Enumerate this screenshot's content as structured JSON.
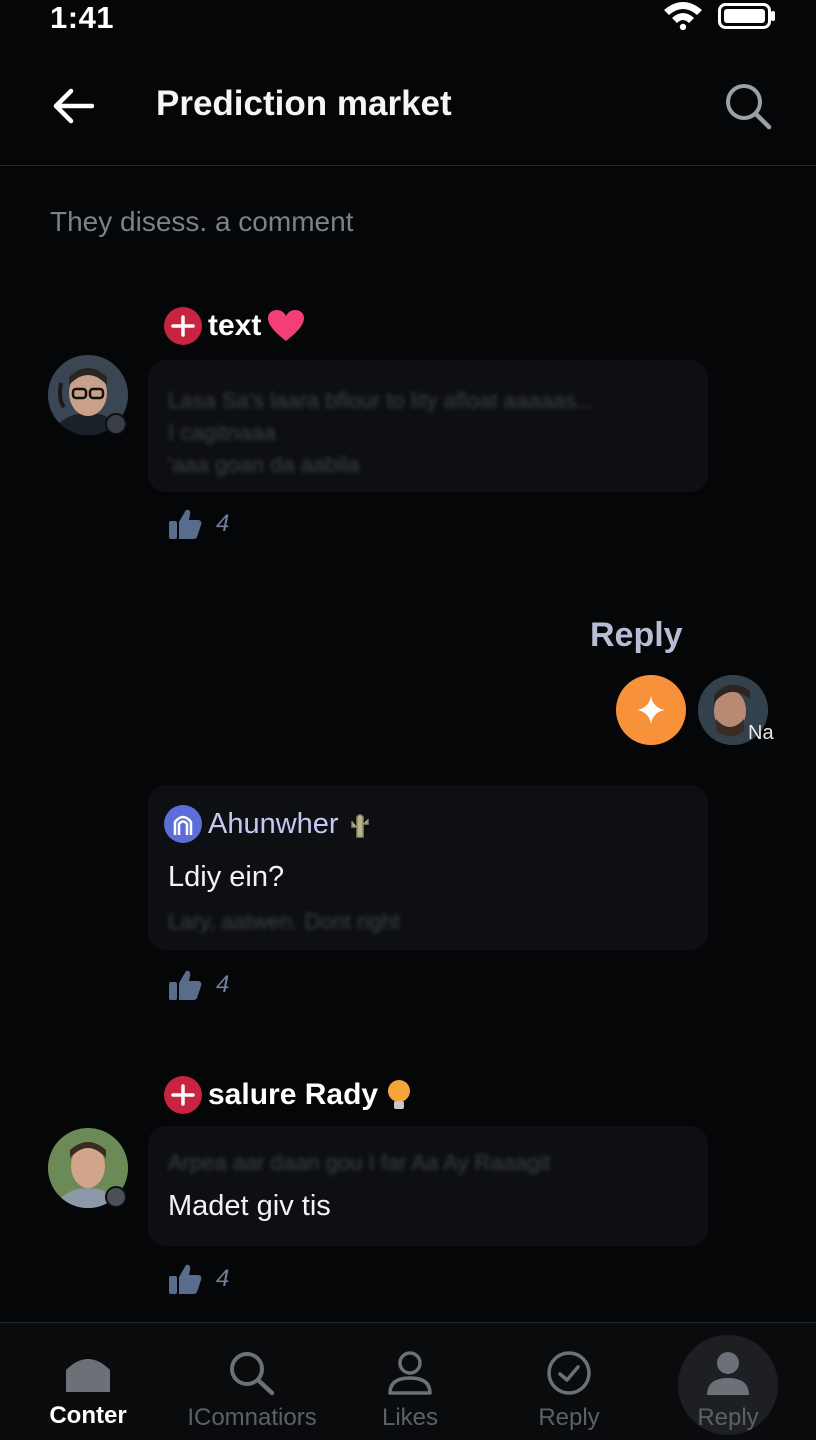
{
  "status_bar": {
    "time": "1:41"
  },
  "header": {
    "title": "Prediction market"
  },
  "section": {
    "subtitle": "They disess. a comment"
  },
  "comments": [
    {
      "author": "text",
      "blurred_lines": [
        "Lasa Sa's laara bflour to lity afloat aaaaas...",
        "I cagitnaaa",
        "'aaa goan da aabila"
      ],
      "likes": "4"
    },
    {
      "author": "Ahunwher",
      "text": "Ldiy ein?",
      "blurred_lines": [
        "Lary, aatwen. Dont right"
      ],
      "likes": "4"
    },
    {
      "author": "salure Rady",
      "text": "Madet giv tis",
      "blurred_lines": [
        "Arpea aar daan gou I far Aa Ay Raaagit"
      ],
      "likes": "4"
    }
  ],
  "reply": {
    "label": "Reply",
    "avatar_tag": "Na"
  },
  "nav": {
    "items": [
      {
        "label": "Conter"
      },
      {
        "label": "IComnatiors"
      },
      {
        "label": "Likes"
      },
      {
        "label": "Reply"
      },
      {
        "label": "Reply"
      }
    ]
  },
  "colors": {
    "background": "#050607",
    "accent_orange": "#f7913a",
    "badge_red": "#c8243f",
    "like_blue": "#6f7f9c",
    "reply_label": "#b7bdd4"
  }
}
